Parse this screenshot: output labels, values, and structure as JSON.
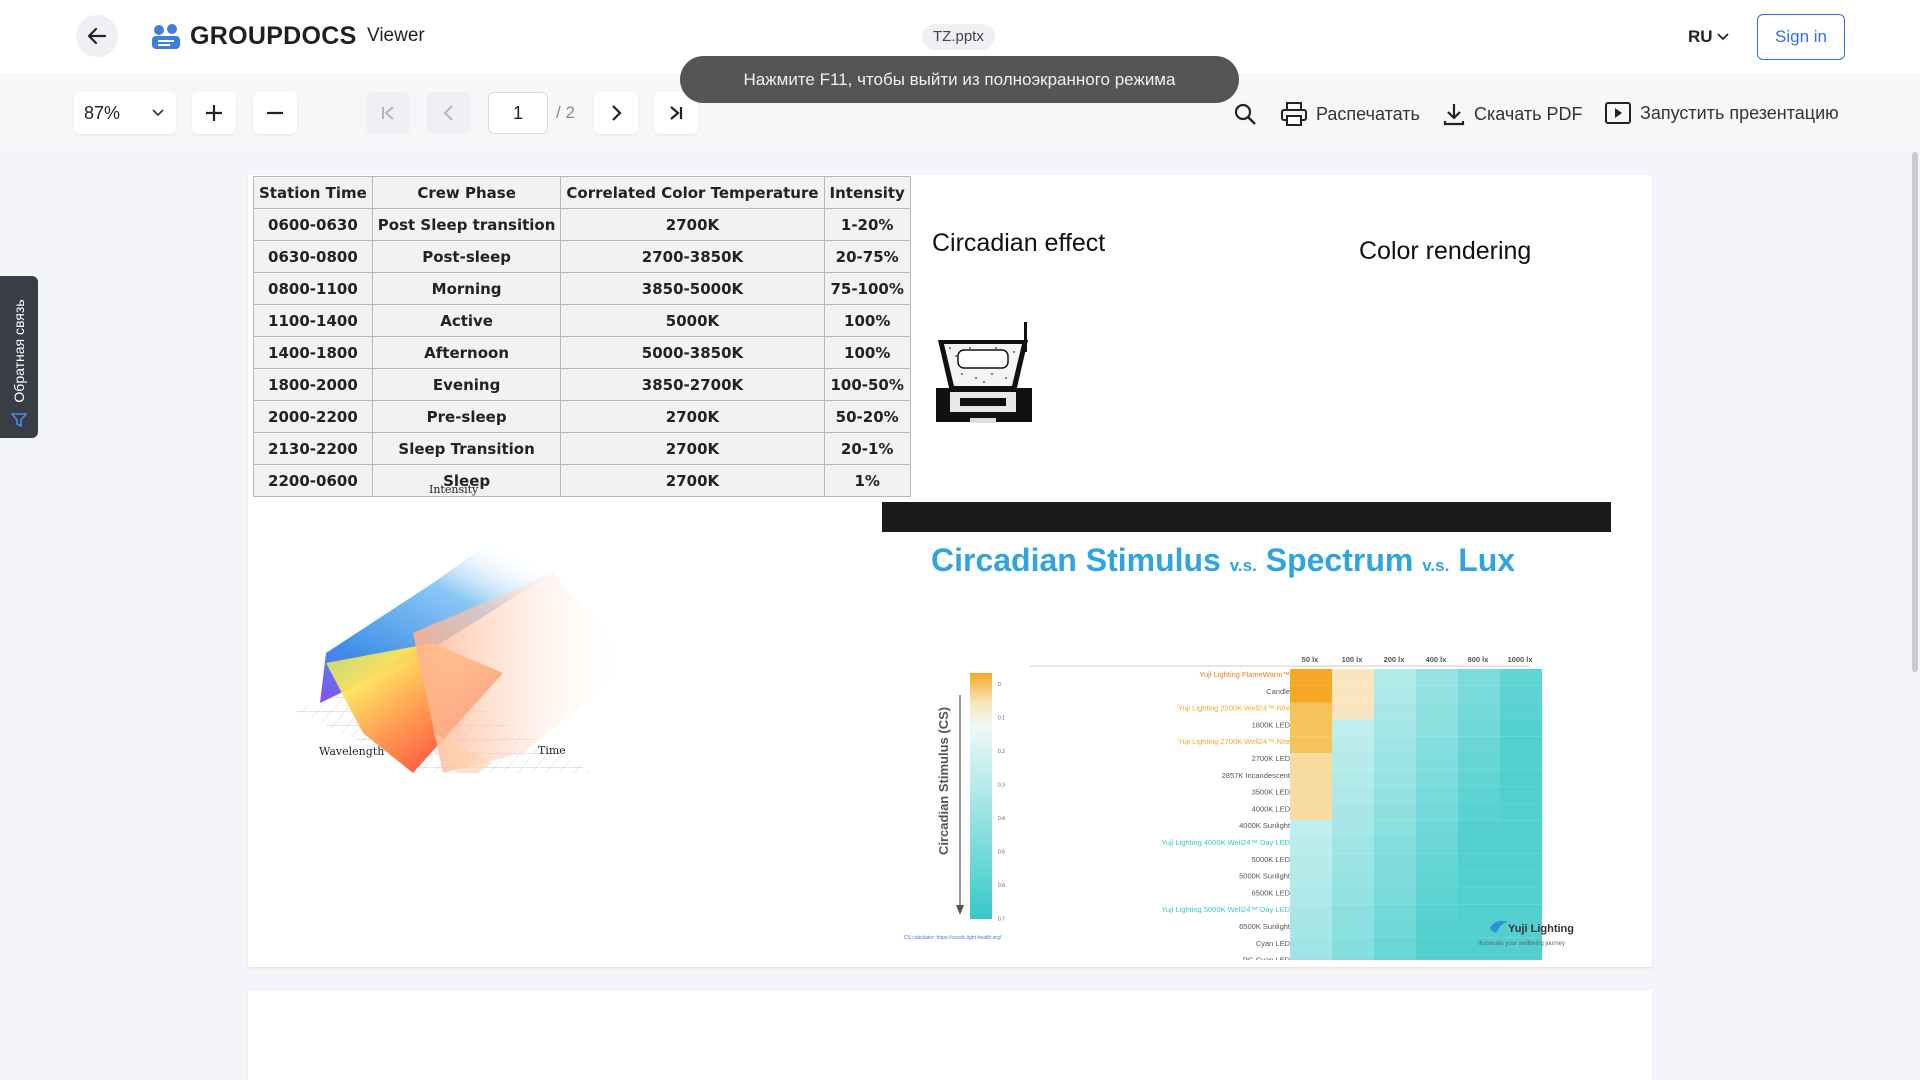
{
  "header": {
    "logo_text": "GROUPDOCS",
    "app_name": "Viewer",
    "file_name": "TZ.pptx",
    "language": "RU",
    "sign_in": "Sign in"
  },
  "toolbar": {
    "zoom": "87%",
    "current_page": "1",
    "total_pages": "/ 2",
    "print": "Распечатать",
    "download_pdf": "Скачать PDF",
    "start_presentation": "Запустить презентацию"
  },
  "toast": "Нажмите F11, чтобы выйти из полноэкранного режима",
  "feedback": "Обратная связь",
  "slide": {
    "table": {
      "headers": [
        "Station Time",
        "Crew Phase",
        "Correlated Color Temperature",
        "Intensity"
      ],
      "rows": [
        [
          "0600-0630",
          "Post Sleep transition",
          "2700K",
          "1-20%"
        ],
        [
          "0630-0800",
          "Post-sleep",
          "2700-3850K",
          "20-75%"
        ],
        [
          "0800-1100",
          "Morning",
          "3850-5000K",
          "75-100%"
        ],
        [
          "1100-1400",
          "Active",
          "5000K",
          "100%"
        ],
        [
          "1400-1800",
          "Afternoon",
          "5000-3850K",
          "100%"
        ],
        [
          "1800-2000",
          "Evening",
          "3850-2700K",
          "100-50%"
        ],
        [
          "2000-2200",
          "Pre-sleep",
          "2700K",
          "50-20%"
        ],
        [
          "2130-2200",
          "Sleep Transition",
          "2700K",
          "20-1%"
        ],
        [
          "2200-0600",
          "Sleep",
          "2700K",
          "1%"
        ]
      ]
    },
    "circadian_effect": "Circadian effect",
    "color_rendering": "Color rendering",
    "surface_plot": {
      "axis_intensity": "Intensity",
      "axis_wavelength": "Wavelength",
      "axis_time": "Time"
    },
    "cs_chart": {
      "title_part1": "Circadian Stimulus",
      "vs": "v.s.",
      "title_part2": "Spectrum",
      "title_part3": "Lux",
      "y_label": "Circadian Stimulus (CS)",
      "lux_columns": [
        "50 lx",
        "100 lx",
        "200 lx",
        "400 lx",
        "800 lx",
        "1000 lx"
      ],
      "scale_ticks": [
        "0",
        "0.1",
        "0.2",
        "0.3",
        "0.4",
        "0.5",
        "0.6",
        "0.7"
      ],
      "sources": [
        "Yuji Lighting FlameWarm™",
        "Candle",
        "Yuji Lighting 2200K Well24™ Nite",
        "1800K LED",
        "Yuji Lighting 2700K Well24™ Nite",
        "2700K LED",
        "2857K Incandescent",
        "3500K LED",
        "4000K LED",
        "4000K Sunlight",
        "Yuji Lighting 4000K Well24™ Day LED",
        "5000K LED",
        "5000K Sunlight",
        "6500K LED",
        "Yuji Lighting 5000K Well24™ Day LED",
        "6500K Sunlight",
        "Cyan LED",
        "PC-Cyan LED"
      ],
      "brand": "Yuji Lighting",
      "brand_tagline": "Illuminate your wellbeing journey",
      "footnote": "CS calculator: https://cscalc.light-health.org/",
      "colors": {
        "warm": "#f4a825",
        "cool": "#36c9c9",
        "title": "#2fa4e0"
      }
    }
  }
}
